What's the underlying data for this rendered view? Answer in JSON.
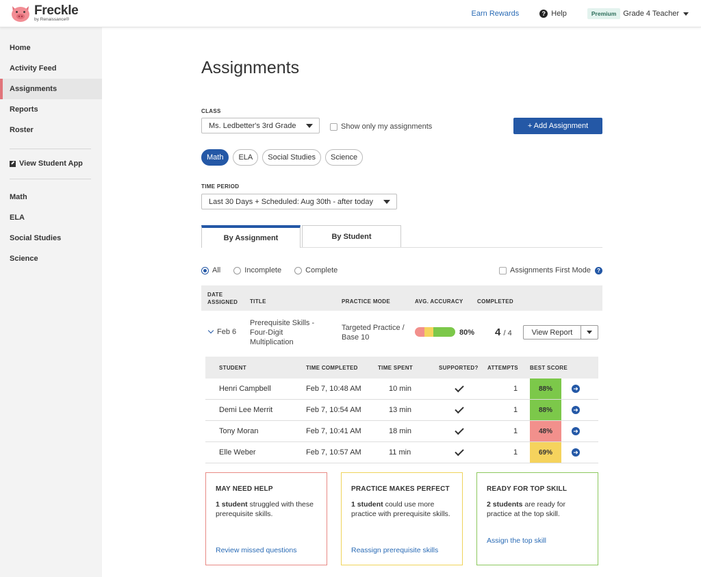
{
  "header": {
    "logo_name": "Freckle",
    "logo_sub": "by Renaissance®",
    "earn_rewards": "Earn Rewards",
    "help": "Help",
    "premium_badge": "Premium",
    "user_label": "Grade 4 Teacher"
  },
  "sidebar": {
    "items": [
      {
        "label": "Home"
      },
      {
        "label": "Activity Feed"
      },
      {
        "label": "Assignments",
        "active": true
      },
      {
        "label": "Reports"
      },
      {
        "label": "Roster"
      }
    ],
    "student_app": "View Student App",
    "subjects": [
      "Math",
      "ELA",
      "Social Studies",
      "Science"
    ]
  },
  "page": {
    "title": "Assignments",
    "class_label": "CLASS",
    "class_value": "Ms. Ledbetter's 3rd Grade",
    "show_only_mine": "Show only my assignments",
    "add_assignment": "+ Add Assignment",
    "subject_pills": [
      {
        "label": "Math",
        "active": true
      },
      {
        "label": "ELA"
      },
      {
        "label": "Social Studies"
      },
      {
        "label": "Science"
      }
    ],
    "time_period_label": "TIME PERIOD",
    "time_period_value": "Last 30 Days + Scheduled: Aug 30th - after today",
    "tabs": [
      "By Assignment",
      "By Student"
    ],
    "filters": [
      "All",
      "Incomplete",
      "Complete"
    ],
    "first_mode": "Assignments First Mode"
  },
  "table": {
    "headers": {
      "date_line1": "DATE",
      "date_line2": "ASSIGNED",
      "title": "TITLE",
      "mode": "PRACTICE MODE",
      "accuracy": "AVG. ACCURACY",
      "completed": "COMPLETED"
    },
    "assignment": {
      "date": "Feb 6",
      "title": "Prerequisite Skills - Four-Digit Multiplication",
      "mode": "Targeted Practice / Base 10",
      "accuracy": "80%",
      "accuracy_segments": {
        "red": 0.23,
        "yellow": 0.22,
        "green": 0.55
      },
      "completed_num": "4",
      "completed_den": "/ 4",
      "view_report": "View Report"
    }
  },
  "students": {
    "headers": {
      "student": "STUDENT",
      "time_completed": "TIME COMPLETED",
      "time_spent": "TIME SPENT",
      "supported": "SUPPORTED?",
      "attempts": "ATTEMPTS",
      "best_score": "BEST SCORE"
    },
    "rows": [
      {
        "name": "Henri Campbell",
        "time": "Feb 7, 10:48 AM",
        "spent": "10 min",
        "attempts": "1",
        "score": "88%",
        "color": "#7cc84a"
      },
      {
        "name": "Demi Lee Merrit",
        "time": "Feb 7, 10:54 AM",
        "spent": "13 min",
        "attempts": "1",
        "score": "88%",
        "color": "#7cc84a"
      },
      {
        "name": "Tony Moran",
        "time": "Feb 7, 10:41 AM",
        "spent": "18 min",
        "attempts": "1",
        "score": "48%",
        "color": "#f2908c"
      },
      {
        "name": "Elle Weber",
        "time": "Feb 7, 10:57 AM",
        "spent": "11 min",
        "attempts": "1",
        "score": "69%",
        "color": "#f5d35d"
      }
    ]
  },
  "cards": [
    {
      "title": "MAY NEED HELP",
      "bold": "1 student",
      "rest": " struggled with these prerequisite skills.",
      "link": "Review missed questions",
      "border": "#e88a85"
    },
    {
      "title": "PRACTICE MAKES PERFECT",
      "bold": "1 student",
      "rest": " could use more practice with prerequisite skills.",
      "link": "Reassign prerequisite skills",
      "border": "#efd35a"
    },
    {
      "title": "READY FOR TOP SKILL",
      "bold": "2 students",
      "rest": " are ready for practice at the top skill.",
      "link": "Assign the top skill",
      "border": "#8cc85e"
    }
  ]
}
